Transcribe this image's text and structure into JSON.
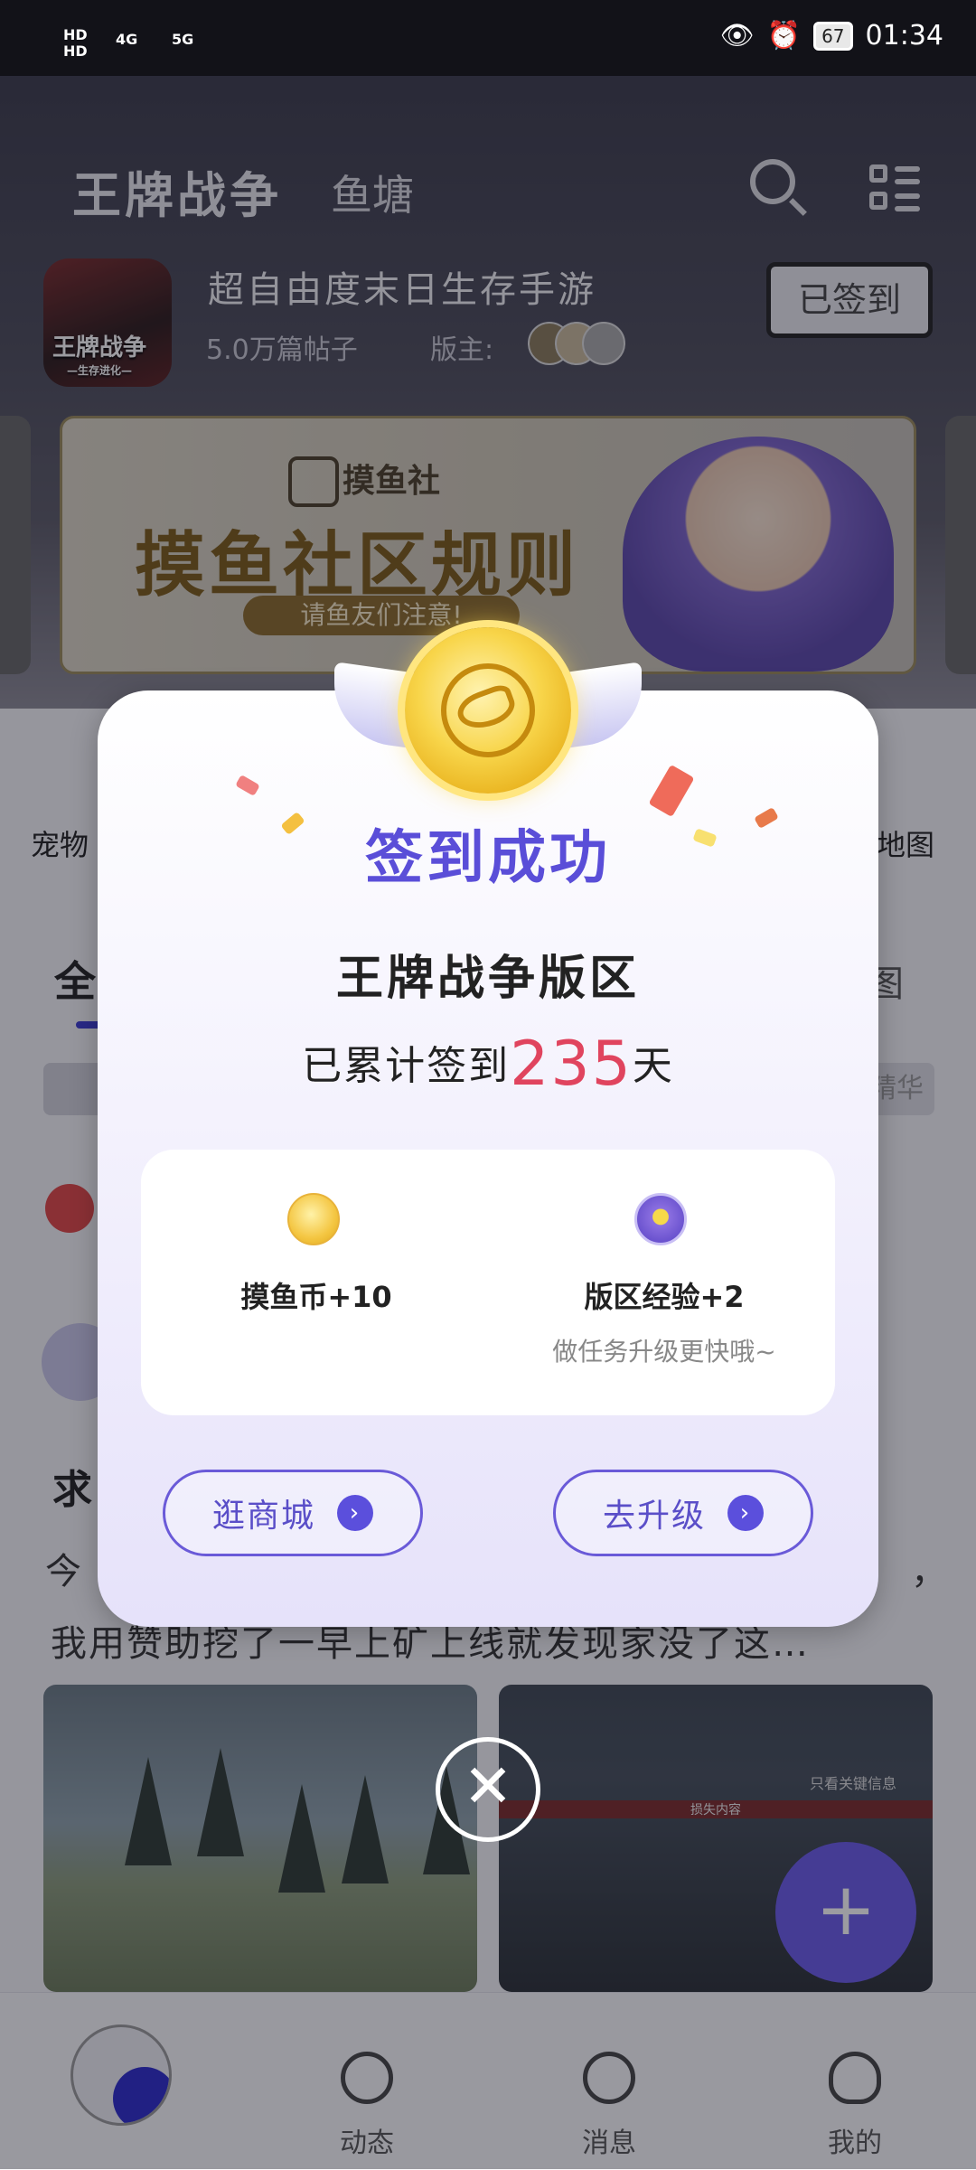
{
  "status_bar": {
    "network_label": "HD\nHD",
    "signal1": "4G",
    "signal2": "5G",
    "battery": "67",
    "time": "01:34"
  },
  "header": {
    "title": "王牌战争",
    "subtab": "鱼塘",
    "icons": [
      "search-icon",
      "menu-icon"
    ]
  },
  "forum": {
    "game_logo_text": "王牌战争",
    "game_logo_sub": "—生存进化—",
    "slogan": "超自由度末日生存手游",
    "posts": "5.0万篇帖子",
    "moderators_label": "版主:",
    "sign_button": "已签到"
  },
  "banner": {
    "brand": "摸鱼社",
    "title": "摸鱼社区规则",
    "pill": "请鱼友们注意!"
  },
  "quick_links": {
    "left": "宠物",
    "right": "地图"
  },
  "tabs": {
    "active": "全",
    "right": "图"
  },
  "chips": {
    "right": "精华"
  },
  "post": {
    "title": "求",
    "line1_start": "今",
    "line1_end": "，",
    "line2": "我用赞助挖了一早上矿上线就发现家没了这…",
    "image2_header": "只看关键信息",
    "image2_col": "损失内容"
  },
  "fab": {
    "label": "+"
  },
  "bottom_nav": {
    "items": [
      {
        "label": "动态",
        "icon": "compass-icon"
      },
      {
        "label": "消息",
        "icon": "message-icon"
      },
      {
        "label": "我的",
        "icon": "profile-icon"
      }
    ]
  },
  "modal": {
    "title": "签到成功",
    "section": "王牌战争版区",
    "days_prefix": "已累计签到",
    "days_count": "235",
    "days_suffix": "天",
    "reward_coin": "摸鱼币+10",
    "reward_exp": "版区经验+2",
    "reward_hint": "做任务升级更快哦~",
    "btn_shop": "逛商城",
    "btn_upgrade": "去升级",
    "btn_arrow": "›",
    "close": "✕"
  },
  "colors": {
    "accent": "#5a4ed8",
    "days_highlight": "#e0445e",
    "fab": "#6a5ae8"
  }
}
